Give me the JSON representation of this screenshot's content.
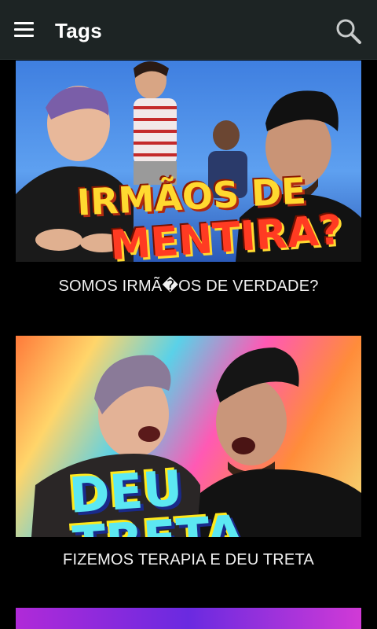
{
  "app_bar": {
    "title": "Tags",
    "menu_icon": "hamburger-menu-icon",
    "search_icon": "search-icon",
    "background": "#1d2424"
  },
  "feed": {
    "items": [
      {
        "title": "SOMOS IRMÃ�OS DE VERDADE?",
        "thumbnail_text": [
          "IRMÃOS DE",
          "MENTIRA?"
        ]
      },
      {
        "title": "FIZEMOS TERAPIA E DEU TRETA",
        "thumbnail_text": [
          "DEU TRETA"
        ]
      },
      {
        "title": "",
        "thumbnail_text": []
      }
    ]
  }
}
